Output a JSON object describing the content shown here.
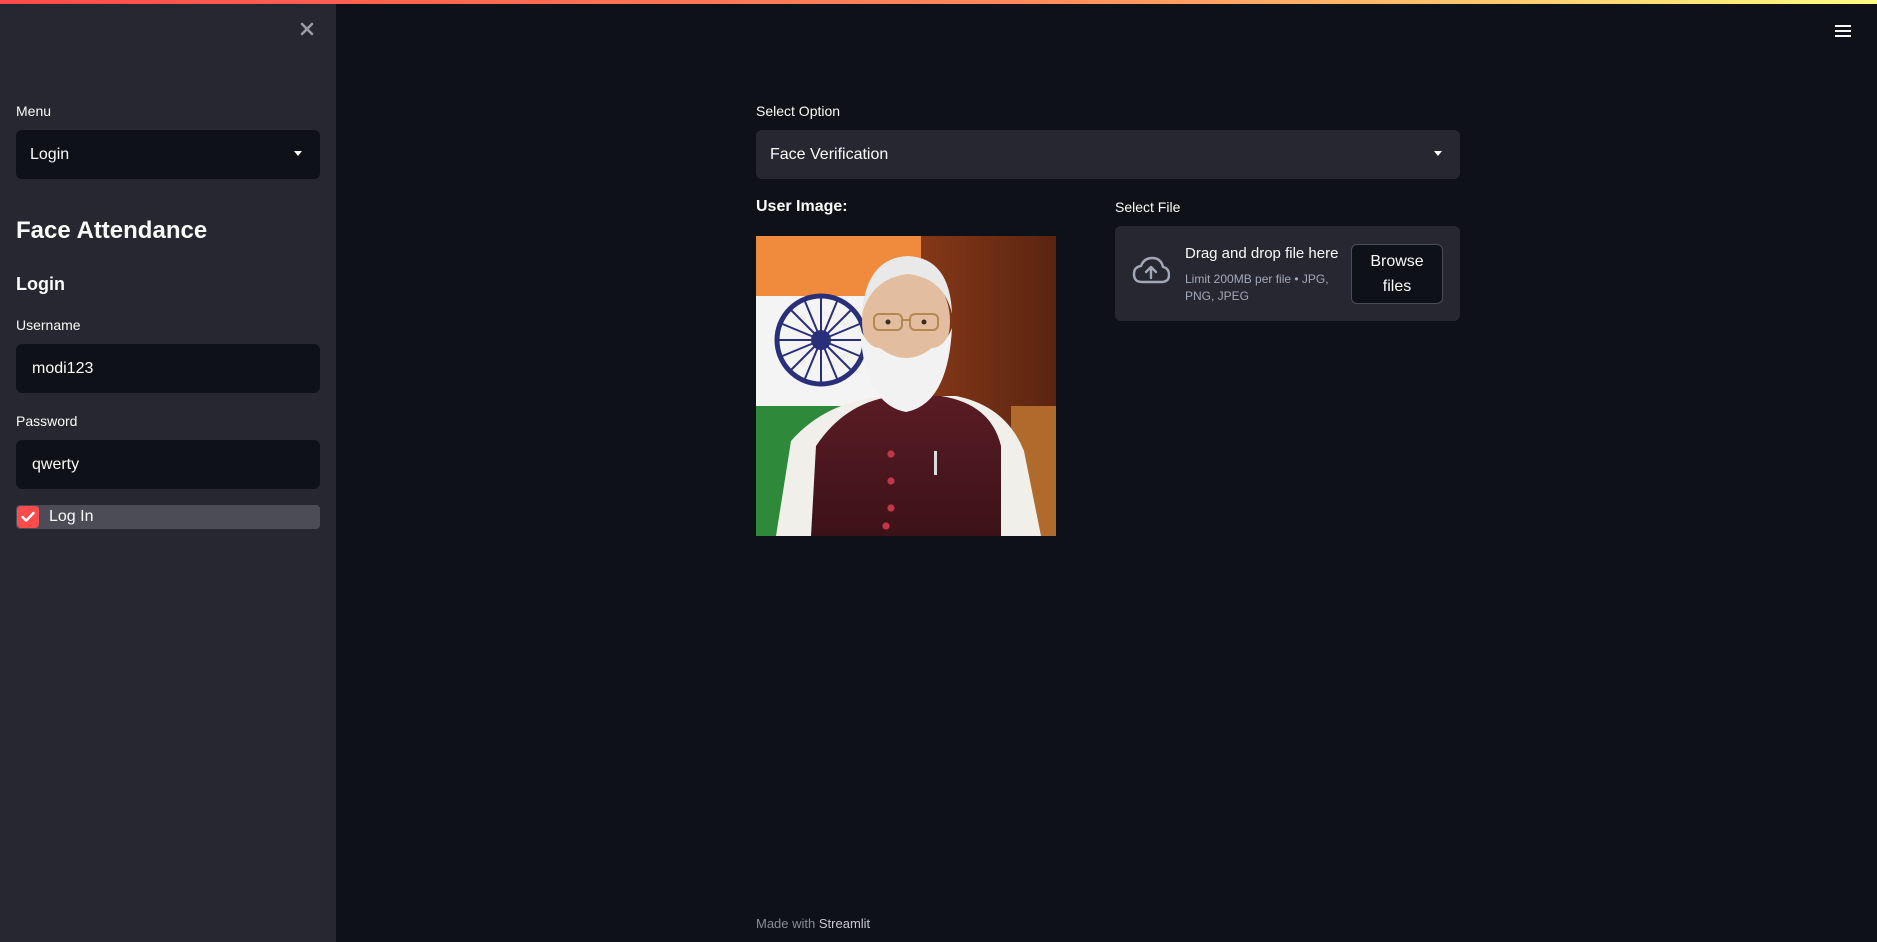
{
  "sidebar": {
    "menu_label": "Menu",
    "menu_selected": "Login",
    "app_title": "Face Attendance",
    "section_title": "Login",
    "username_label": "Username",
    "username_value": "modi123",
    "password_label": "Password",
    "password_value": "qwerty",
    "login_checkbox_label": "Log In",
    "login_checked": true
  },
  "main": {
    "select_option_label": "Select Option",
    "select_option_value": "Face Verification",
    "user_image_label": "User Image:",
    "select_file_label": "Select File",
    "dropzone_title": "Drag and drop file here",
    "dropzone_subtitle": "Limit 200MB per file • JPG, PNG, JPEG",
    "browse_button": "Browse files"
  },
  "footer": {
    "made_with": "Made with",
    "brand": "Streamlit"
  },
  "colors": {
    "accent": "#ff4b4b",
    "background": "#0e1117",
    "sidebar": "#262730"
  }
}
